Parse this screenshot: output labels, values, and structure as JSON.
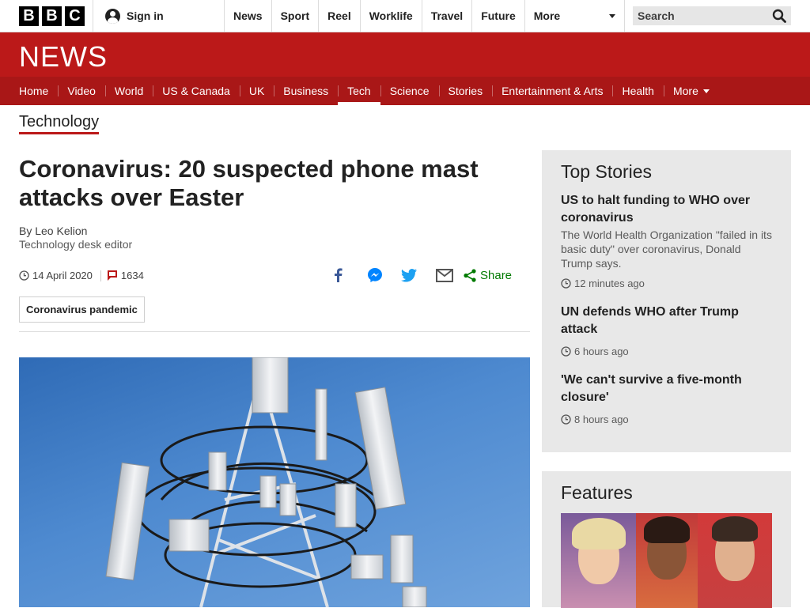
{
  "topbar": {
    "logo_letters": [
      "B",
      "B",
      "C"
    ],
    "signin_label": "Sign in",
    "nav": [
      "News",
      "Sport",
      "Reel",
      "Worklife",
      "Travel",
      "Future"
    ],
    "more_label": "More",
    "search_placeholder": "Search"
  },
  "brand": {
    "news_label": "NEWS",
    "color": "#bb1919"
  },
  "section_nav": {
    "items": [
      "Home",
      "Video",
      "World",
      "US & Canada",
      "UK",
      "Business",
      "Tech",
      "Science",
      "Stories",
      "Entertainment & Arts",
      "Health"
    ],
    "active": "Tech",
    "more_label": "More"
  },
  "section_title": "Technology",
  "article": {
    "headline": "Coronavirus: 20 suspected phone mast attacks over Easter",
    "author": "By Leo Kelion",
    "role": "Technology desk editor",
    "date": "14 April 2020",
    "comments": "1634",
    "share_label": "Share",
    "tag": "Coronavirus pandemic"
  },
  "top_stories": {
    "heading": "Top Stories",
    "items": [
      {
        "title": "US to halt funding to WHO over coronavirus",
        "summary": "The World Health Organization \"failed in its basic duty\" over coronavirus, Donald Trump says.",
        "time": "12 minutes ago"
      },
      {
        "title": "UN defends WHO after Trump attack",
        "time": "6 hours ago"
      },
      {
        "title": "'We can't survive a five-month closure'",
        "time": "8 hours ago"
      }
    ]
  },
  "features": {
    "heading": "Features"
  }
}
